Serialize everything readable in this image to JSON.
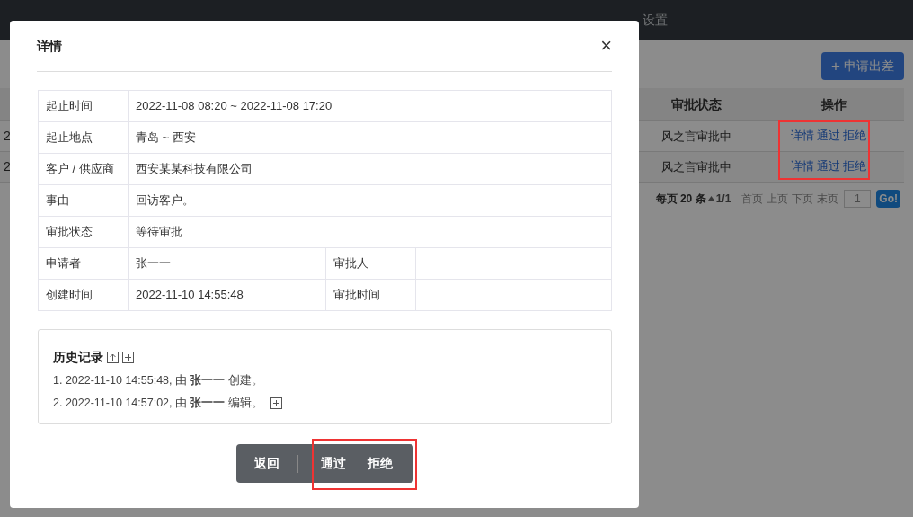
{
  "nav": {
    "items": [
      {
        "label": "设置"
      }
    ]
  },
  "page": {
    "action_button": {
      "icon": "+",
      "label": "申请出差"
    },
    "table": {
      "columns": [
        "审批状态",
        "操作"
      ],
      "rows": [
        {
          "column_1": "2",
          "status": "风之言审批中",
          "actions": [
            "详情",
            "通过",
            "拒绝"
          ]
        },
        {
          "column_1": "2",
          "status": "风之言审批中",
          "actions": [
            "详情",
            "通过",
            "拒绝"
          ]
        }
      ]
    },
    "pagination": {
      "per_page_prefix": "每页",
      "per_page": "20",
      "per_page_suffix": "条",
      "page_info": "1/1",
      "links": [
        "首页",
        "上页",
        "下页",
        "末页"
      ],
      "page_input": "1",
      "go": "Go!"
    }
  },
  "modal": {
    "title": "详情",
    "close": "×",
    "rows": [
      {
        "kind": "full",
        "label": "起止时间",
        "value": "2022-11-08 08:20 ~ 2022-11-08 17:20"
      },
      {
        "kind": "full",
        "label": "起止地点",
        "value": "青岛 ~ 西安"
      },
      {
        "kind": "full",
        "label": "客户 / 供应商",
        "value": "西安某某科技有限公司"
      },
      {
        "kind": "full",
        "label": "事由",
        "value": "回访客户。"
      },
      {
        "kind": "full",
        "label": "审批状态",
        "value": "等待审批"
      },
      {
        "kind": "pair",
        "label": "申请者",
        "value": "张一一",
        "label_2": "审批人"
      },
      {
        "kind": "pair",
        "label": "创建时间",
        "value": "2022-11-10 14:55:48",
        "label_2": "审批时间"
      }
    ],
    "history": {
      "title": "历史记录",
      "entries": [
        {
          "text": "1. 2022-11-10 14:55:48, 由 **张一一** 创建。",
          "expandable": false
        },
        {
          "text": "2. 2022-11-10 14:57:02, 由 **张一一** 编辑。",
          "expandable": true
        }
      ]
    },
    "footer_buttons": [
      "返回",
      "通过",
      "拒绝"
    ]
  }
}
